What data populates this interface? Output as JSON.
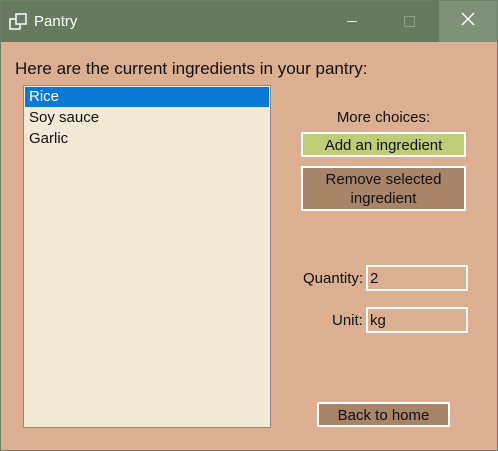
{
  "window": {
    "title": "Pantry",
    "icons": {
      "app": "app-window-icon",
      "minimize": "minimize-icon",
      "maximize": "maximize-icon",
      "close": "close-icon"
    }
  },
  "main": {
    "intro": "Here are the current ingredients in your pantry:",
    "ingredients": [
      "Rice",
      "Soy sauce",
      "Garlic"
    ],
    "selected_index": 0
  },
  "actions": {
    "more_label": "More choices:",
    "add_label": "Add an ingredient",
    "remove_label_line1": "Remove selected",
    "remove_label_line2": "ingredient",
    "home_label": "Back to home"
  },
  "fields": {
    "quantity_label": "Quantity:",
    "quantity_value": "2",
    "unit_label": "Unit:",
    "unit_value": "kg"
  },
  "colors": {
    "titlebar": "#657a5f",
    "background": "#dcaf91",
    "listbox": "#f1e9d6",
    "selection": "#0a78d7",
    "add_button": "#c0cd78",
    "brown_button": "#a88468"
  }
}
